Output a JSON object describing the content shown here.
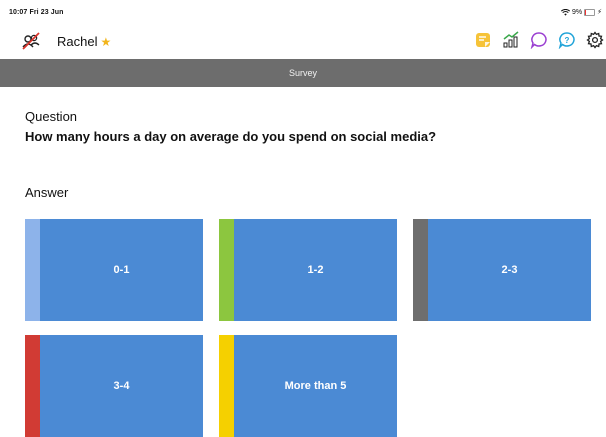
{
  "status_bar": {
    "time": "10:07",
    "date": "Fri 23 Jun",
    "battery_percent": "9%",
    "icons": [
      "wifi-icon",
      "battery-icon",
      "charging-icon"
    ]
  },
  "header": {
    "user_name": "Rachel",
    "star": "★",
    "avatar_icon": "no-people-icon",
    "toolbar_icons": [
      "sticky-note-icon",
      "stats-icon",
      "chat-icon",
      "help-icon",
      "settings-icon"
    ]
  },
  "section": {
    "title": "Survey"
  },
  "question": {
    "label": "Question",
    "text": "How many hours a day on average do you spend on social media?"
  },
  "answer": {
    "label": "Answer",
    "options": [
      {
        "label": "0-1",
        "stripe_color": "#8db3ea"
      },
      {
        "label": "1-2",
        "stripe_color": "#8cc63f"
      },
      {
        "label": "2-3",
        "stripe_color": "#6e6e6e"
      },
      {
        "label": "3-4",
        "stripe_color": "#d13b34"
      },
      {
        "label": "More than 5",
        "stripe_color": "#f5d000"
      }
    ]
  },
  "colors": {
    "tile_blue": "#4b8ad4",
    "section_bar": "#6d6d6d",
    "accent_yellow": "#f2b51c"
  }
}
